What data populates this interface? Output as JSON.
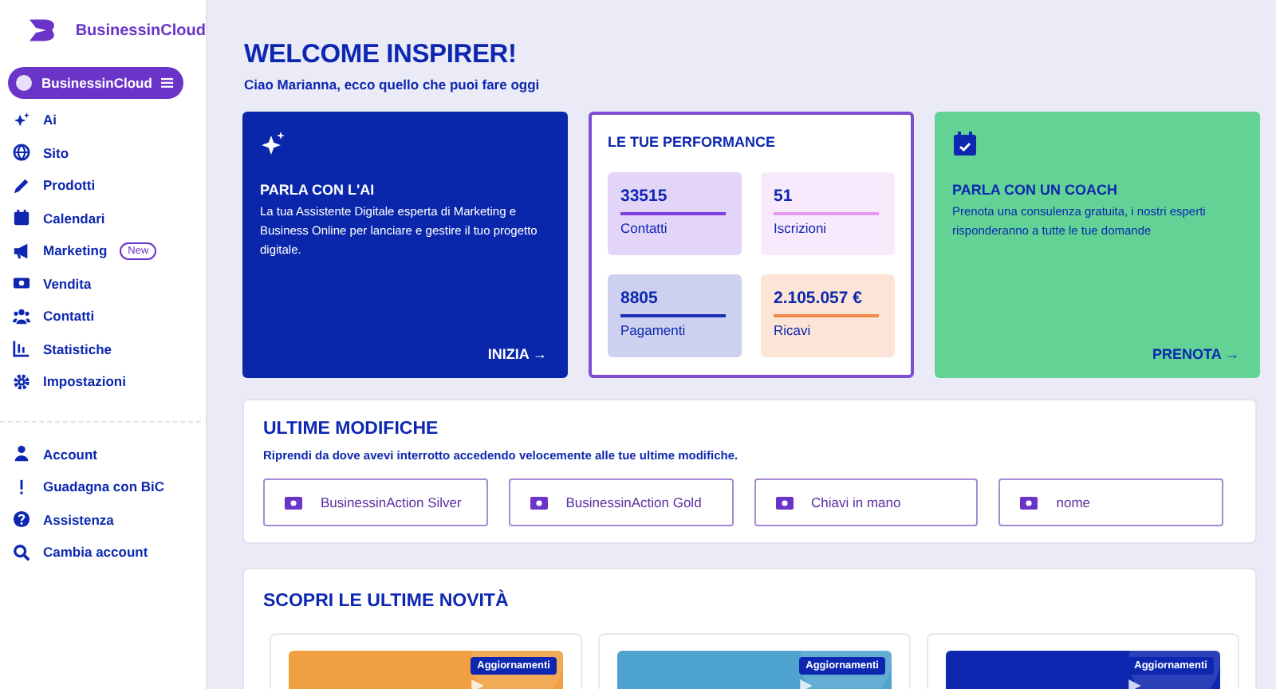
{
  "brand": {
    "name": "BusinessinCloud"
  },
  "workspace": {
    "label": "BusinessinCloud"
  },
  "nav": [
    {
      "label": "Ai"
    },
    {
      "label": "Sito"
    },
    {
      "label": "Prodotti"
    },
    {
      "label": "Calendari"
    },
    {
      "label": "Marketing",
      "badge": "New"
    },
    {
      "label": "Vendita"
    },
    {
      "label": "Contatti"
    },
    {
      "label": "Statistiche"
    },
    {
      "label": "Impostazioni"
    }
  ],
  "nav_bottom": [
    {
      "label": "Account"
    },
    {
      "label": "Guadagna con BiC"
    },
    {
      "label": "Assistenza"
    },
    {
      "label": "Cambia account"
    }
  ],
  "header": {
    "title": "WELCOME INSPIRER!",
    "subtitle": "Ciao Marianna, ecco quello che puoi fare oggi"
  },
  "ai_card": {
    "title": "PARLA CON L'AI",
    "text": "La tua Assistente Digitale esperta di Marketing e Business Online per lanciare e gestire il tuo progetto digitale.",
    "action": "INIZIA →"
  },
  "performance": {
    "title": "LE TUE PERFORMANCE",
    "stats": [
      {
        "value": "33515",
        "label": "Contatti",
        "color": "#7b3fe0"
      },
      {
        "value": "51",
        "label": "Iscrizioni",
        "color": "#e59af0"
      },
      {
        "value": "8805",
        "label": "Pagamenti",
        "color": "#1a30b8"
      },
      {
        "value": "2.105.057 €",
        "label": "Ricavi",
        "color": "#f08a4b"
      }
    ]
  },
  "coach_card": {
    "title": "PARLA CON UN COACH",
    "text": "Prenota una consulenza gratuita, i nostri esperti risponderanno a tutte le tue domande",
    "action": "PRENOTA →"
  },
  "recent": {
    "title": "ULTIME MODIFICHE",
    "subtitle": "Riprendi da dove avevi interrotto accedendo velocemente alle tue ultime modifiche.",
    "items": [
      "BusinessinAction Silver",
      "BusinessinAction Gold",
      "Chiavi in mano",
      "nome"
    ]
  },
  "news": {
    "title": "SCOPRI LE ULTIME NOVITÀ",
    "cards": [
      {
        "kind": "picture",
        "tag": "Aggiornamenti",
        "color": "#f0a040"
      },
      {
        "kind": "picture",
        "tag": "Aggiornamenti",
        "color": "#4fa3cf"
      },
      {
        "kind": "picture",
        "tag": "Aggiornamenti",
        "color": "#0d27b0"
      }
    ]
  }
}
